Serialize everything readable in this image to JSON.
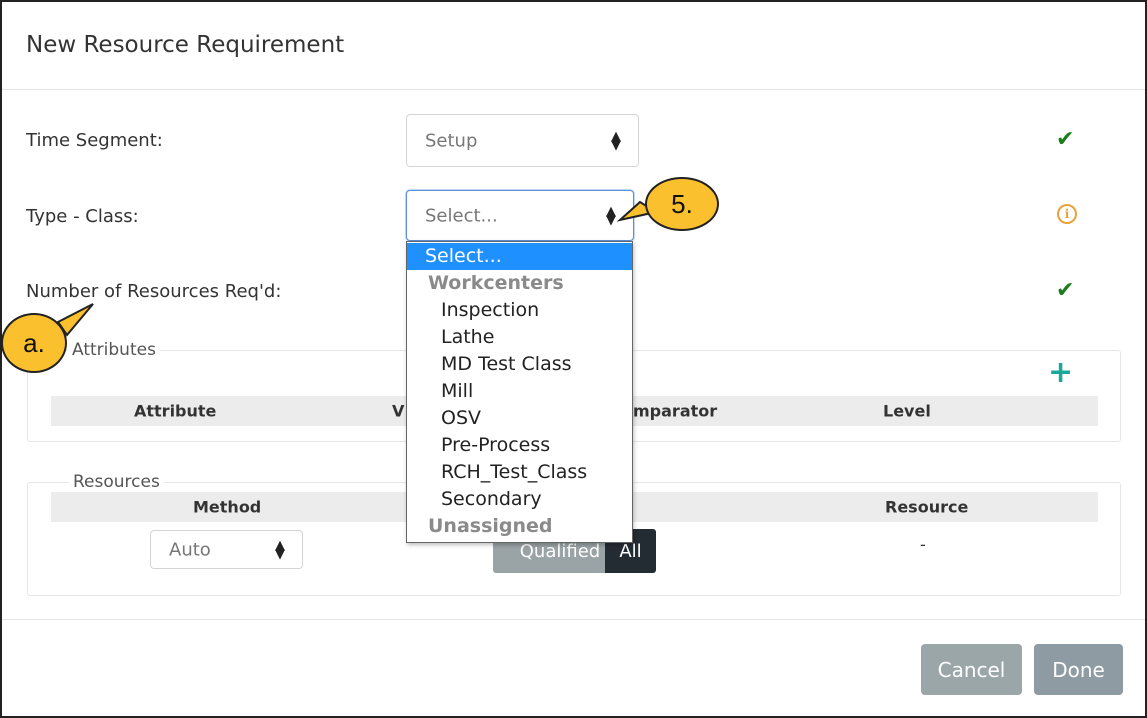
{
  "dialog": {
    "title": "New Resource Requirement"
  },
  "form": {
    "time_segment_label": "Time Segment:",
    "time_segment_value": "Setup",
    "type_class_label": "Type - Class:",
    "type_class_value": "Select...",
    "num_resources_label": "Number of Resources Req'd:"
  },
  "status_icons": {
    "time_segment": "check-icon",
    "type_class": "info-icon",
    "num_resources": "check-icon"
  },
  "dropdown": {
    "items": [
      {
        "label": "Select...",
        "kind": "selected"
      },
      {
        "label": "Workcenters",
        "kind": "group"
      },
      {
        "label": "Inspection",
        "kind": "option"
      },
      {
        "label": "Lathe",
        "kind": "option"
      },
      {
        "label": "MD Test Class",
        "kind": "option"
      },
      {
        "label": "Mill",
        "kind": "option"
      },
      {
        "label": "OSV",
        "kind": "option"
      },
      {
        "label": "Pre-Process",
        "kind": "option"
      },
      {
        "label": "RCH_Test_Class",
        "kind": "option"
      },
      {
        "label": "Secondary",
        "kind": "option"
      },
      {
        "label": "Unassigned",
        "kind": "group"
      }
    ]
  },
  "attributes": {
    "legend": "Attributes",
    "columns": [
      "Attribute",
      "V",
      "mparator",
      "Level"
    ]
  },
  "resources": {
    "legend": "Resources",
    "columns": [
      "Method",
      "Resource"
    ],
    "method_value": "Auto",
    "toggle": {
      "qualified": "Qualified",
      "all": "All"
    },
    "resource_value": "-"
  },
  "footer": {
    "cancel": "Cancel",
    "done": "Done"
  },
  "callouts": {
    "step": "5.",
    "label": "a."
  },
  "colors": {
    "accent_green": "#1a7d1a",
    "info_orange": "#e8a33a",
    "add_teal": "#1aa89a",
    "dropdown_highlight": "#1e90ff",
    "callout_fill": "#fbc02d"
  }
}
